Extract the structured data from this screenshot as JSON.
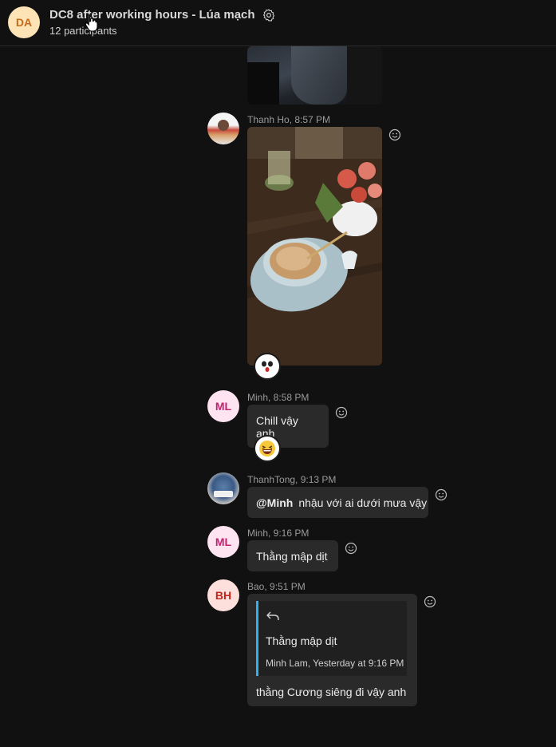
{
  "header": {
    "avatar_initials": "DA",
    "title": "DC8 after working hours - Lúa mạch",
    "participants": "12 participants"
  },
  "messages": [
    {
      "sender_time": "Thanh Ho, 8:57 PM",
      "type": "image",
      "reaction": "shocked-face"
    },
    {
      "sender_time": "Minh, 8:58 PM",
      "avatar_initials": "ML",
      "text": "Chill vậy anh",
      "reaction": "laughing-face"
    },
    {
      "sender_time": "ThanhTong, 9:13 PM",
      "mention": "@Minh",
      "text": "nhậu với ai dưới mưa vậy"
    },
    {
      "sender_time": "Minh, 9:16 PM",
      "avatar_initials": "ML",
      "text": "Thằng mập dịt"
    },
    {
      "sender_time": "Bao, 9:51 PM",
      "avatar_initials": "BH",
      "quote": {
        "text": "Thằng mập dịt",
        "author_time": "Minh Lam, Yesterday at 9:16 PM"
      },
      "text": "thằng Cương siêng đi vậy anh"
    }
  ],
  "colors": {
    "background": "#111111",
    "bubble": "#2a2a2a",
    "quote_accent": "#2bb3f0"
  }
}
